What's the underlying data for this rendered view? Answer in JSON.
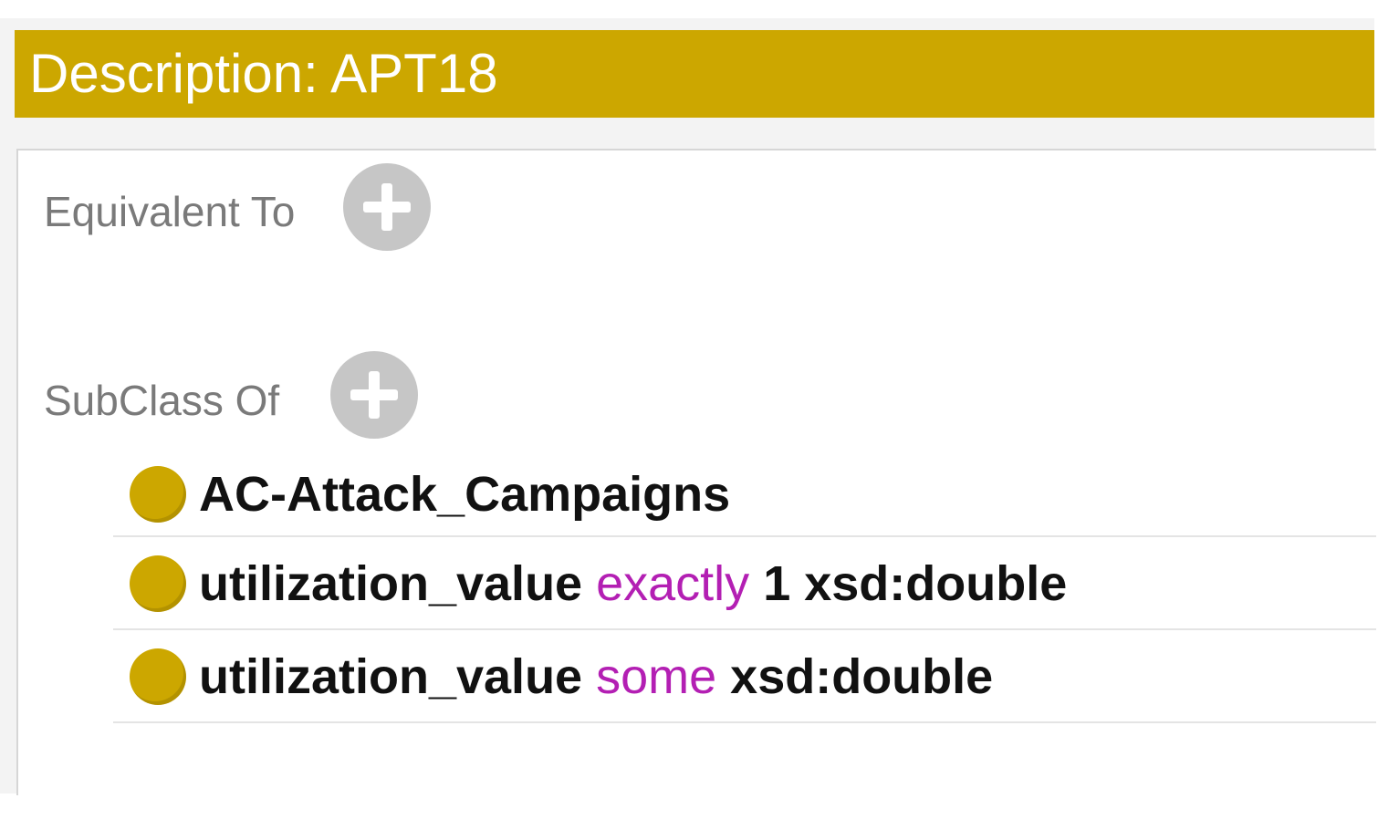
{
  "panel": {
    "title": "Description: APT18",
    "accent_color": "#cca700"
  },
  "sections": {
    "equivalent_to": {
      "label": "Equivalent To",
      "add_icon": "plus-circle-icon"
    },
    "subclass_of": {
      "label": "SubClass Of",
      "add_icon": "plus-circle-icon",
      "axioms": [
        {
          "subject": "AC-Attack_Campaigns",
          "keyword": "",
          "object": ""
        },
        {
          "subject": "utilization_value",
          "keyword": "exactly",
          "object": "1 xsd:double"
        },
        {
          "subject": "utilization_value",
          "keyword": "some",
          "object": "xsd:double"
        }
      ]
    }
  },
  "colors": {
    "keyword": "#b31fb3",
    "bullet": "#cca700",
    "label": "#7a7a7a"
  }
}
